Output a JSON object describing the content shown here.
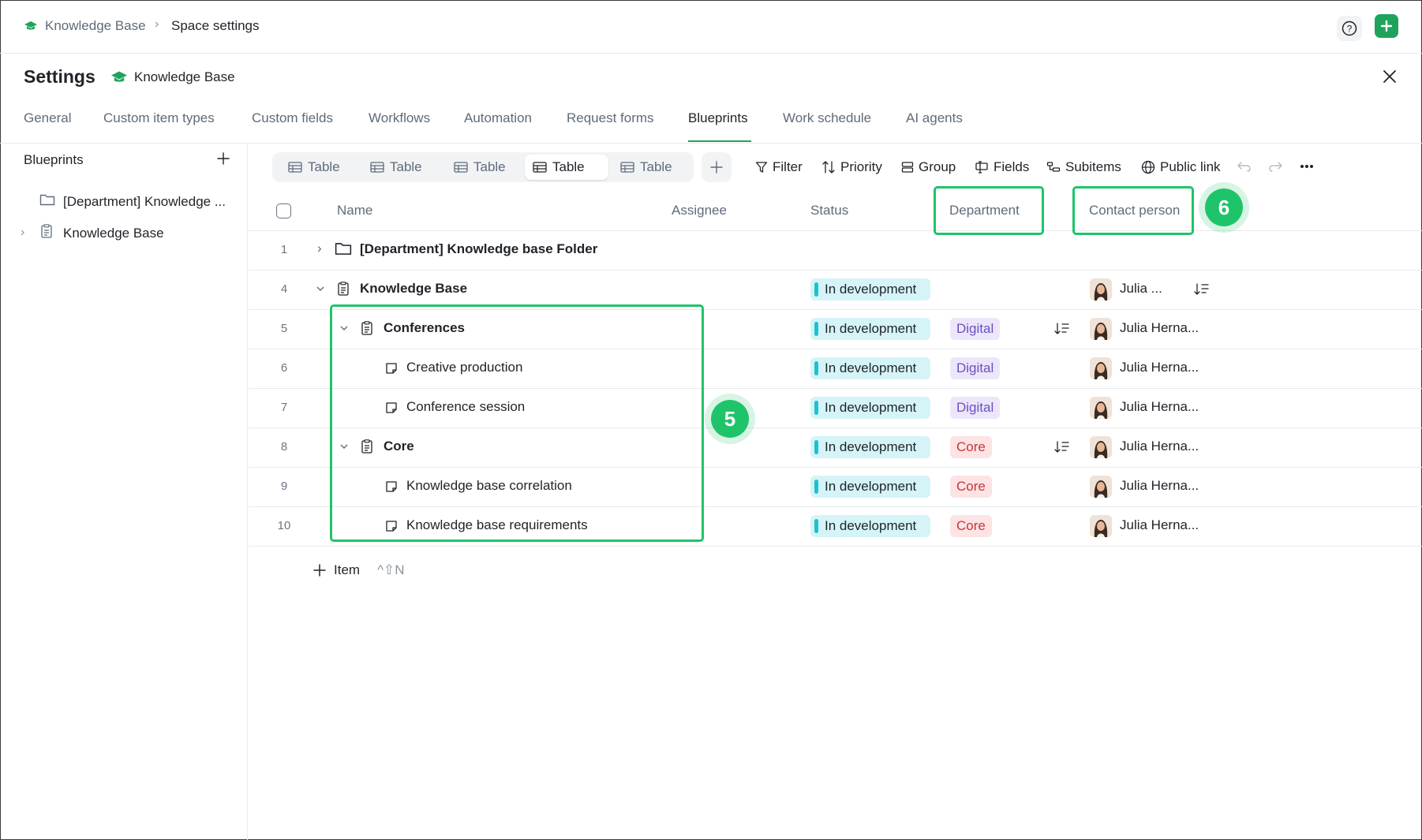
{
  "breadcrumb": {
    "space": "Knowledge Base",
    "current": "Space settings"
  },
  "header": {
    "title": "Settings",
    "space_name": "Knowledge Base"
  },
  "tabs": [
    "General",
    "Custom item types",
    "Custom fields",
    "Workflows",
    "Automation",
    "Request forms",
    "Blueprints",
    "Work schedule",
    "AI agents"
  ],
  "active_tab": "Blueprints",
  "sidebar": {
    "title": "Blueprints",
    "items": [
      {
        "label": "[Department] Knowledge ...",
        "icon": "folder-icon"
      },
      {
        "label": "Knowledge Base",
        "icon": "document-icon"
      }
    ]
  },
  "views": [
    "Table",
    "Table",
    "Table",
    "Table",
    "Table"
  ],
  "active_view_index": 3,
  "toolbar": {
    "filter": "Filter",
    "priority": "Priority",
    "group": "Group",
    "fields": "Fields",
    "subitems": "Subitems",
    "public_link": "Public link"
  },
  "columns": {
    "name": "Name",
    "assignee": "Assignee",
    "status": "Status",
    "department": "Department",
    "contact": "Contact person"
  },
  "rows": [
    {
      "num": "1",
      "name": "[Department] Knowledge base Folder"
    },
    {
      "num": "4",
      "name": "Knowledge Base",
      "status": "In development",
      "contact": "Julia ..."
    },
    {
      "num": "5",
      "name": "Conferences",
      "status": "In development",
      "department": "Digital",
      "contact": "Julia Herna..."
    },
    {
      "num": "6",
      "name": "Creative production",
      "status": "In development",
      "department": "Digital",
      "contact": "Julia Herna..."
    },
    {
      "num": "7",
      "name": "Conference session",
      "status": "In development",
      "department": "Digital",
      "contact": "Julia Herna..."
    },
    {
      "num": "8",
      "name": "Core",
      "status": "In development",
      "department": "Core",
      "contact": "Julia Herna..."
    },
    {
      "num": "9",
      "name": "Knowledge base correlation",
      "status": "In development",
      "department": "Core",
      "contact": "Julia Herna..."
    },
    {
      "num": "10",
      "name": "Knowledge base requirements",
      "status": "In development",
      "department": "Core",
      "contact": "Julia Herna..."
    }
  ],
  "add_item": {
    "label": "Item",
    "shortcut": "^⇧N"
  },
  "callouts": {
    "five": "5",
    "six": "6"
  },
  "colors": {
    "accent": "#1fa35c",
    "highlight": "#1fc46a",
    "status": "#d5f4f7",
    "digital": "#ece6fb",
    "core": "#fde3e3"
  }
}
